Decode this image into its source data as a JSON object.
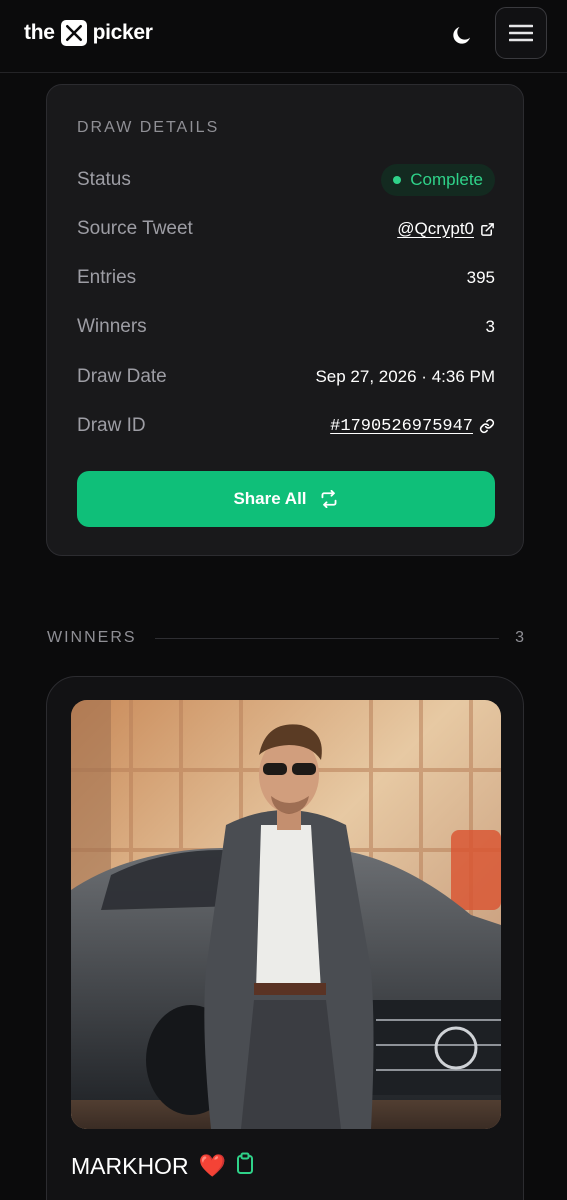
{
  "header": {
    "logo_left": "the",
    "logo_right": "picker",
    "theme_icon": "moon-icon",
    "menu_icon": "hamburger-menu-icon"
  },
  "draw_details": {
    "title": "DRAW DETAILS",
    "status": {
      "label": "Status",
      "value": "Complete",
      "color": "#2fd289"
    },
    "source_tweet": {
      "label": "Source Tweet",
      "value": "@Qcrypt0",
      "icon": "external-link-icon"
    },
    "entries": {
      "label": "Entries",
      "value": "395"
    },
    "winners": {
      "label": "Winners",
      "value": "3"
    },
    "draw_date": {
      "label": "Draw Date",
      "value": "Sep 27, 2026 · 4:36 PM"
    },
    "draw_id": {
      "label": "Draw ID",
      "value": "#1790526975947",
      "icon": "link-icon"
    },
    "share_button": {
      "label": "Share All",
      "icon": "repost-icon",
      "color": "#0fbf79"
    }
  },
  "winners_section": {
    "title": "WINNERS",
    "count": "3",
    "items": [
      {
        "name": "MARKHOR",
        "emoji": "❤️",
        "copy_icon": "clipboard-icon"
      }
    ]
  }
}
